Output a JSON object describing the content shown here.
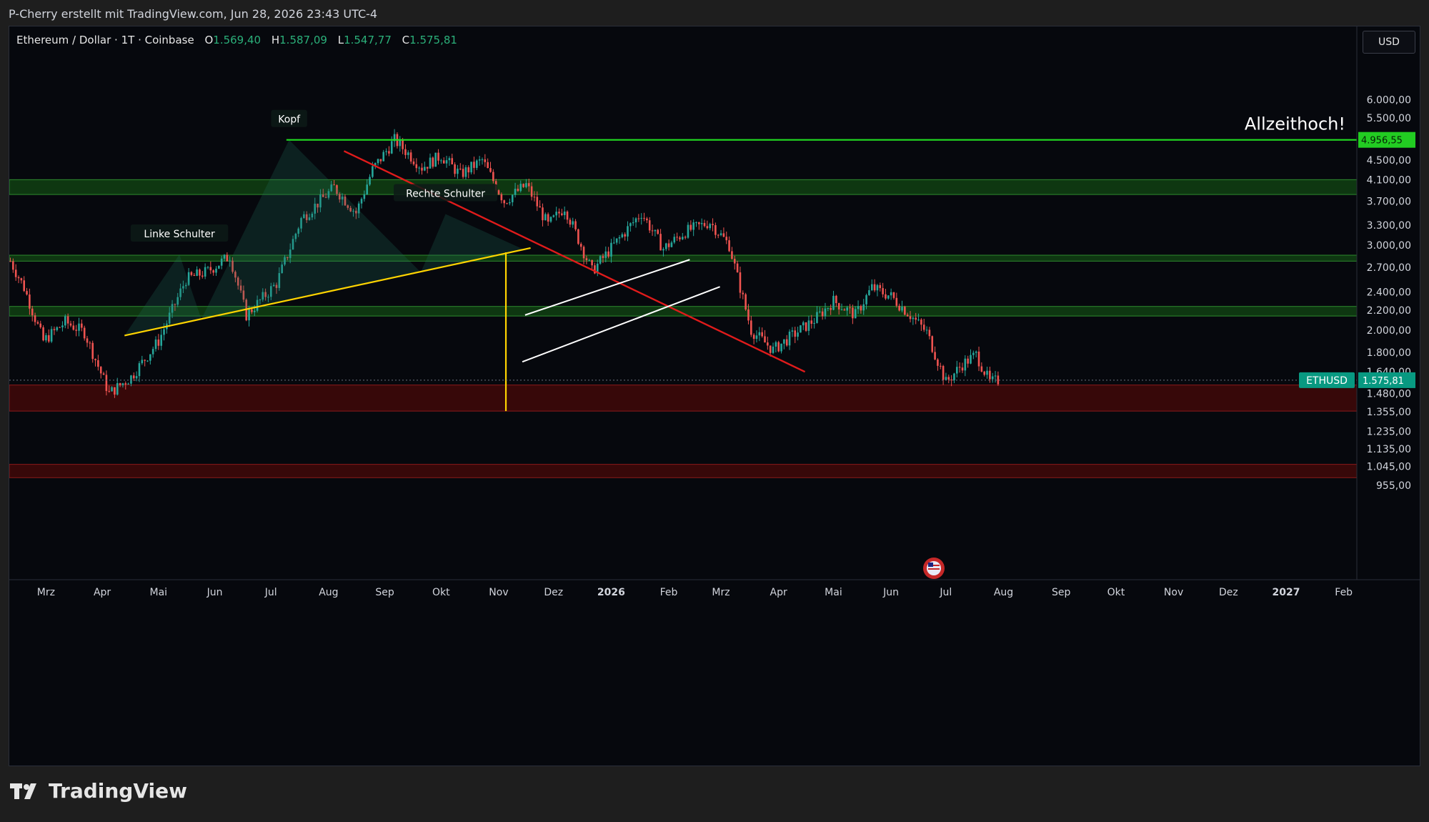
{
  "header": {
    "caption": "P-Cherry erstellt mit TradingView.com, Jun 28, 2026 23:43 UTC-4"
  },
  "legend": {
    "symbol": "Ethereum / Dollar · 1T · Coinbase",
    "open_label": "O",
    "open": "1.569,40",
    "high_label": "H",
    "high": "1.587,09",
    "low_label": "L",
    "low": "1.547,77",
    "close_label": "C",
    "close": "1.575,81"
  },
  "currency": "USD",
  "brand": {
    "name": "TradingView"
  },
  "chart_data": {
    "type": "candlestick",
    "symbol": "ETHUSD",
    "y_scale": "log",
    "ylim": [
      900,
      6500
    ],
    "y_ticks": [
      {
        "v": 6000,
        "label": "6.000,00"
      },
      {
        "v": 5500,
        "label": "5.500,00"
      },
      {
        "v": 4500,
        "label": "4.500,00"
      },
      {
        "v": 4100,
        "label": "4.100,00"
      },
      {
        "v": 3700,
        "label": "3.700,00"
      },
      {
        "v": 3300,
        "label": "3.300,00"
      },
      {
        "v": 3000,
        "label": "3.000,00"
      },
      {
        "v": 2700,
        "label": "2.700,00"
      },
      {
        "v": 2400,
        "label": "2.400,00"
      },
      {
        "v": 2200,
        "label": "2.200,00"
      },
      {
        "v": 2000,
        "label": "2.000,00"
      },
      {
        "v": 1800,
        "label": "1.800,00"
      },
      {
        "v": 1640,
        "label": "1.640,00"
      },
      {
        "v": 1480,
        "label": "1.480,00"
      },
      {
        "v": 1355,
        "label": "1.355,00"
      },
      {
        "v": 1235,
        "label": "1.235,00"
      },
      {
        "v": 1135,
        "label": "1.135,00"
      },
      {
        "v": 1045,
        "label": "1.045,00"
      },
      {
        "v": 955,
        "label": "955,00"
      }
    ],
    "x_ticks": [
      "Mrz",
      "Apr",
      "Mai",
      "Jun",
      "Jul",
      "Aug",
      "Sep",
      "Okt",
      "Nov",
      "Dez",
      "2026",
      "Feb",
      "Mrz",
      "Apr",
      "Mai",
      "Jun",
      "Jul",
      "Aug",
      "Sep",
      "Okt",
      "Nov",
      "Dez",
      "2027",
      "Feb"
    ],
    "price_path": [
      [
        2780,
        0
      ],
      [
        2450,
        5
      ],
      [
        1900,
        12
      ],
      [
        2080,
        20
      ],
      [
        1980,
        27
      ],
      [
        1480,
        36
      ],
      [
        1600,
        44
      ],
      [
        1900,
        54
      ],
      [
        2550,
        64
      ],
      [
        2650,
        72
      ],
      [
        2850,
        80
      ],
      [
        2150,
        86
      ],
      [
        2500,
        97
      ],
      [
        3400,
        106
      ],
      [
        3950,
        118
      ],
      [
        3500,
        126
      ],
      [
        4300,
        132
      ],
      [
        4956,
        140
      ],
      [
        4350,
        150
      ],
      [
        4600,
        157
      ],
      [
        4200,
        164
      ],
      [
        4500,
        172
      ],
      [
        3700,
        180
      ],
      [
        4000,
        188
      ],
      [
        3300,
        196
      ],
      [
        3600,
        202
      ],
      [
        2650,
        212
      ],
      [
        3100,
        222
      ],
      [
        3500,
        230
      ],
      [
        2950,
        238
      ],
      [
        3200,
        246
      ],
      [
        3350,
        255
      ],
      [
        3000,
        262
      ],
      [
        2000,
        270
      ],
      [
        1820,
        278
      ],
      [
        1950,
        285
      ],
      [
        2100,
        293
      ],
      [
        2300,
        300
      ],
      [
        2150,
        308
      ],
      [
        2450,
        314
      ],
      [
        2350,
        321
      ],
      [
        2150,
        328
      ],
      [
        1980,
        334
      ],
      [
        1560,
        341
      ],
      [
        1700,
        347
      ],
      [
        1780,
        352
      ],
      [
        1560,
        357
      ],
      [
        1575,
        360
      ]
    ],
    "last_price": {
      "label": "ETHUSD",
      "value": "1.575,81",
      "v": 1575.81
    },
    "ath": {
      "value": "4.956,55",
      "v": 4956.55,
      "annotation": "Allzeithoch!"
    },
    "zones": [
      {
        "type": "support-resistance",
        "lo": 3820,
        "hi": 4100,
        "color": "#1b5e20"
      },
      {
        "type": "support-resistance",
        "lo": 2780,
        "hi": 2860,
        "color": "#1b5e20"
      },
      {
        "type": "support-resistance",
        "lo": 2140,
        "hi": 2240,
        "color": "#1b5e20"
      },
      {
        "type": "demand",
        "lo": 1360,
        "hi": 1540,
        "color": "#7a0d0d"
      },
      {
        "type": "demand",
        "lo": 990,
        "hi": 1055,
        "color": "#7a0d0d"
      }
    ],
    "annotations": [
      {
        "text": "Linke Schulter"
      },
      {
        "text": "Kopf"
      },
      {
        "text": "Rechte Schulter"
      }
    ],
    "trendlines": [
      {
        "name": "neckline",
        "color": "#ffd400"
      },
      {
        "name": "descending-resistance",
        "color": "#e01b1b"
      },
      {
        "name": "channel-upper",
        "color": "#ffffff"
      },
      {
        "name": "channel-lower",
        "color": "#ffffff"
      },
      {
        "name": "target-projection",
        "color": "#ffd400"
      }
    ],
    "colors": {
      "up": "#26a69a",
      "down": "#ef5350",
      "background": "#06080d",
      "ath_line": "#22dd22",
      "price_badge": "#089981"
    }
  }
}
